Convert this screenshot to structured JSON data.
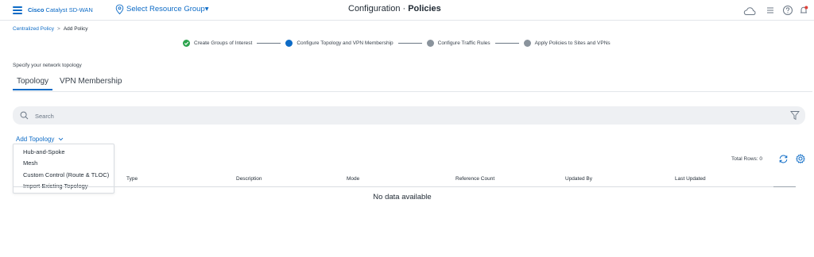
{
  "header": {
    "brand_bold": "Cisco",
    "brand_rest": "Catalyst SD-WAN",
    "resource_group": "Select Resource Group▾",
    "title_prefix": "Configuration ·",
    "title_bold": "Policies",
    "icons": [
      "menu-icon",
      "location-pin-icon",
      "cloud-icon",
      "list-icon",
      "help-icon",
      "notification-bell-icon"
    ]
  },
  "breadcrumb": {
    "parent": "Centralized Policy",
    "separator": ">",
    "current": "Add Policy"
  },
  "steps": [
    {
      "label": "Create Groups of Interest",
      "state": "complete",
      "color": "#2da44e"
    },
    {
      "label": "Configure Topology and VPN Membership",
      "state": "current",
      "color": "#0d6bc6"
    },
    {
      "label": "Configure Traffic Rules",
      "state": "pending",
      "color": "#8a939c"
    },
    {
      "label": "Apply Policies to Sites and VPNs",
      "state": "pending",
      "color": "#8a939c"
    }
  ],
  "section": {
    "instruction": "Specify your network topology"
  },
  "tabs": [
    {
      "label": "Topology",
      "active": true
    },
    {
      "label": "VPN Membership",
      "active": false
    }
  ],
  "search": {
    "placeholder": "Search"
  },
  "add_topology": {
    "label": "Add Topology",
    "menu": [
      "Hub-and-Spoke",
      "Mesh",
      "Custom Control (Route & TLOC)",
      "Import Existing Topology"
    ]
  },
  "table": {
    "total_rows": "Total Rows: 0",
    "columns": [
      "Type",
      "Description",
      "Mode",
      "Reference Count",
      "Updated By",
      "Last Updated"
    ],
    "empty_message": "No data available"
  },
  "colors": {
    "accent": "#0d6bc6",
    "success": "#2da44e",
    "pending": "#8a939c"
  }
}
